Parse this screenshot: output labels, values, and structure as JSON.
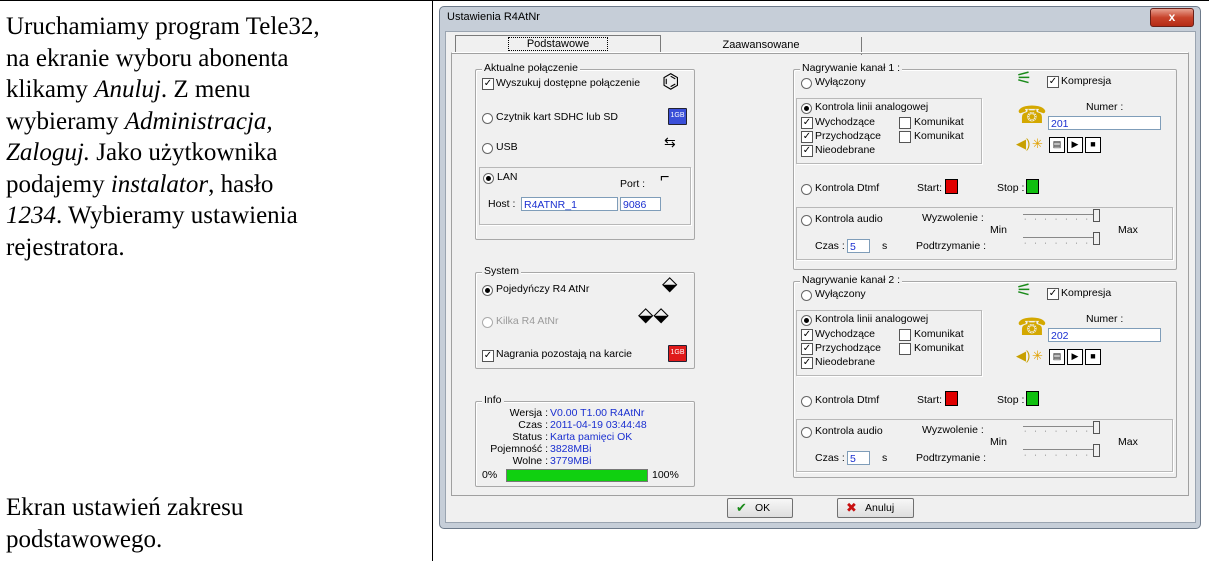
{
  "doc": {
    "para1_lines": [
      "Uruchamiamy program Tele32,",
      "na ekranie wyboru abonenta",
      "klikamy ",
      "wybieramy ",
      "Zaloguj.",
      "podajemy ",
      "1234",
      "rejestratora."
    ],
    "p_l3_italic": "Anuluj",
    "p_l3_rest": ". Z menu",
    "p_l4_italic": "Administracja,",
    "p_l5_rest": " Jako użytkownika",
    "p_l6_italic": "instalator",
    "p_l6_rest": ", hasło",
    "p_l7_rest": ". Wybieramy ustawienia",
    "caption_l1": "Ekran ustawień zakresu",
    "caption_l2": "podstawowego."
  },
  "window": {
    "title": "Ustawienia R4AtNr",
    "close_label": "x"
  },
  "tabs": [
    "Podstawowe",
    "Zaawansowane"
  ],
  "conn": {
    "legend": "Aktualne połączenie",
    "search": "Wyszukuj dostępne połączenie",
    "sd_reader": "Czytnik kart SDHC lub SD",
    "usb": "USB",
    "lan": "LAN",
    "port_label": "Port :",
    "host_label": "Host :",
    "host_value": "R4ATNR_1",
    "port_value": "9086",
    "sd_icon_text": "1GB"
  },
  "system": {
    "legend": "System",
    "single": "Pojedyńczy R4 AtNr",
    "multi": "Kilka R4 AtNr",
    "recordings": "Nagrania pozostają na karcie",
    "card_text": "1GB"
  },
  "info": {
    "legend": "Info",
    "rows": [
      {
        "label": "Wersja :",
        "value": "V0.00  T1.00  R4AtNr"
      },
      {
        "label": "Czas :",
        "value": "2011-04-19  03:44:48"
      },
      {
        "label": "Status :",
        "value": "Karta pamięci OK"
      },
      {
        "label": "Pojemność :",
        "value": "3828MBi"
      },
      {
        "label": "Wolne :",
        "value": "3779MBi"
      }
    ],
    "progress_min": "0%",
    "progress_max": "100%",
    "progress_fraction": 1.0
  },
  "channels": [
    {
      "legend": "Nagrywanie kanał 1 :",
      "off": "Wyłączony",
      "compression": "Kompresja",
      "analog": "Kontrola linii analogowej",
      "number_label": "Numer :",
      "number_value": "201",
      "outgoing": "Wychodzące",
      "incoming": "Przychodzące",
      "message": "Komunikat",
      "missed": "Nieodebrane",
      "dtmf": "Kontrola Dtmf",
      "start": "Start:",
      "stop": "Stop :",
      "audio": "Kontrola audio",
      "trigger": "Wyzwolenie :",
      "min": "Min",
      "max": "Max",
      "time_label": "Czas :",
      "time_value": "5",
      "time_unit": "s",
      "hold": "Podtrzymanie :"
    },
    {
      "legend": "Nagrywanie kanał 2 :",
      "off": "Wyłączony",
      "compression": "Kompresja",
      "analog": "Kontrola linii analogowej",
      "number_label": "Numer :",
      "number_value": "202",
      "outgoing": "Wychodzące",
      "incoming": "Przychodzące",
      "message": "Komunikat",
      "missed": "Nieodebrane",
      "dtmf": "Kontrola Dtmf",
      "start": "Start:",
      "stop": "Stop :",
      "audio": "Kontrola audio",
      "trigger": "Wyzwolenie :",
      "min": "Min",
      "max": "Max",
      "time_label": "Czas :",
      "time_value": "5",
      "time_unit": "s",
      "hold": "Podtrzymanie :"
    }
  ],
  "buttons": {
    "ok": "OK",
    "cancel": "Anuluj"
  },
  "colors": {
    "accent_blue": "#1a2fd0",
    "progress_green": "#10d010",
    "start_red": "#e00000",
    "stop_green": "#10c010"
  }
}
